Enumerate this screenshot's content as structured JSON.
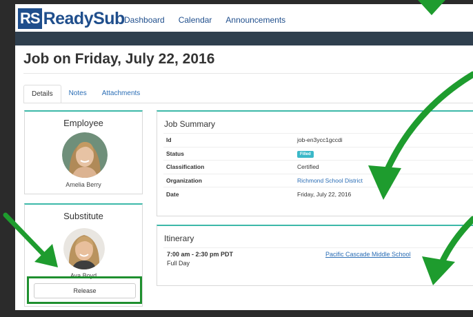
{
  "app": {
    "logo_badge": "RS",
    "logo_word": "ReadySub"
  },
  "nav": [
    {
      "label": "Dashboard"
    },
    {
      "label": "Calendar"
    },
    {
      "label": "Announcements"
    }
  ],
  "page": {
    "title": "Job on Friday, July 22, 2016"
  },
  "tabs": [
    {
      "label": "Details",
      "active": true
    },
    {
      "label": "Notes",
      "active": false
    },
    {
      "label": "Attachments",
      "active": false
    }
  ],
  "employee": {
    "heading": "Employee",
    "name": "Amelia Berry"
  },
  "substitute": {
    "heading": "Substitute",
    "name": "Ava Boyd",
    "release_label": "Release"
  },
  "summary": {
    "title": "Job Summary",
    "rows": [
      {
        "key": "Id",
        "value": "job-en3ycc1gccdi"
      },
      {
        "key": "Status",
        "value": "Filled"
      },
      {
        "key": "Classification",
        "value": "Certified"
      },
      {
        "key": "Organization",
        "value": "Richmond School District"
      },
      {
        "key": "Date",
        "value": "Friday, July 22, 2016"
      }
    ]
  },
  "itinerary": {
    "title": "Itinerary",
    "time": "7:00 am - 2:30 pm PDT",
    "duration": "Full Day",
    "school": "Pacific Cascade Middle School"
  },
  "colors": {
    "brand": "#1f4e8c",
    "accent": "#3bb8a8",
    "link": "#2a6db5",
    "annotation": "#1e8f2e"
  }
}
